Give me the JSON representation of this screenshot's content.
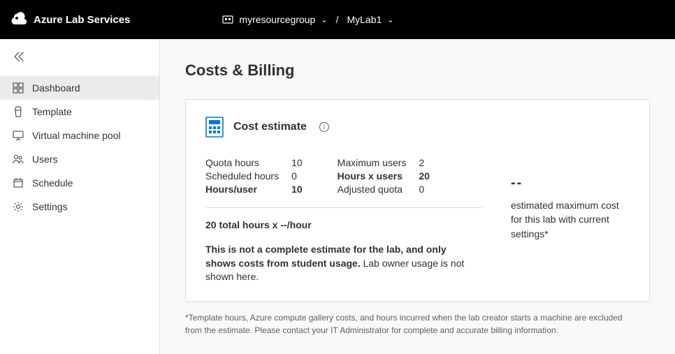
{
  "header": {
    "product_name": "Azure Lab Services",
    "resource_group": "myresourcegroup",
    "lab_name": "MyLab1"
  },
  "sidebar": {
    "items": [
      {
        "label": "Dashboard"
      },
      {
        "label": "Template"
      },
      {
        "label": "Virtual machine pool"
      },
      {
        "label": "Users"
      },
      {
        "label": "Schedule"
      },
      {
        "label": "Settings"
      }
    ]
  },
  "page": {
    "title": "Costs & Billing",
    "card_title": "Cost estimate",
    "metrics_left": {
      "quota_hours_label": "Quota hours",
      "quota_hours_value": "10",
      "scheduled_hours_label": "Scheduled hours",
      "scheduled_hours_value": "0",
      "hours_per_user_label": "Hours/user",
      "hours_per_user_value": "10"
    },
    "metrics_right": {
      "max_users_label": "Maximum users",
      "max_users_value": "2",
      "hours_x_users_label": "Hours x users",
      "hours_x_users_value": "20",
      "adjusted_quota_label": "Adjusted quota",
      "adjusted_quota_value": "0"
    },
    "formula": "20 total hours x --/hour",
    "note_strong": "This is not a complete estimate for the lab, and only shows costs from student usage.",
    "note_rest": " Lab owner usage is not shown here.",
    "summary_value": "--",
    "summary_text": "estimated maximum cost for this lab with current settings*",
    "footnote": "*Template hours, Azure compute gallery costs, and hours incurred when the lab creator starts a machine are excluded from the estimate. Please contact your IT Administrator for complete and accurate billing information."
  }
}
